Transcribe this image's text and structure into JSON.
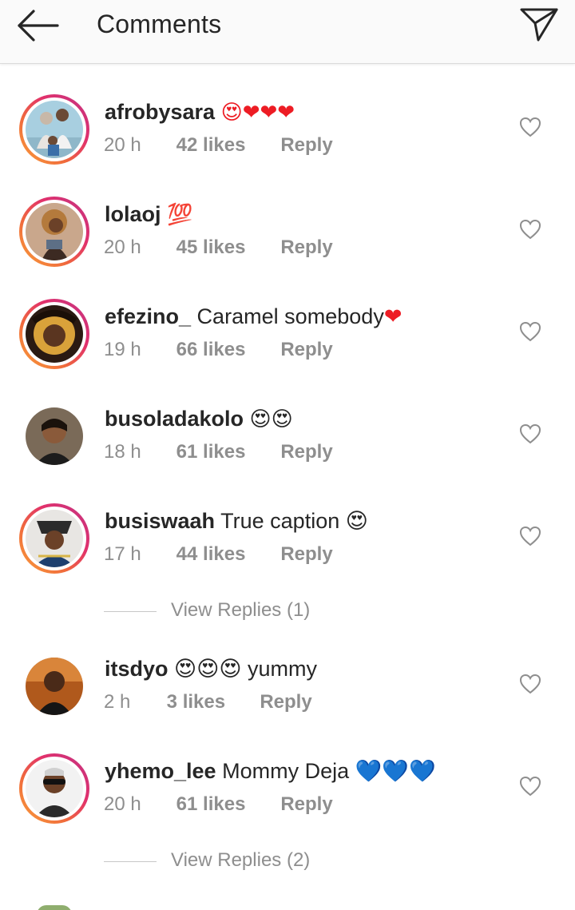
{
  "header": {
    "title": "Comments",
    "back_icon": "arrow-left-icon",
    "send_icon": "paper-plane-icon"
  },
  "comments": [
    {
      "username": "afrobysara",
      "text": "😍❤❤❤",
      "time": "20 h",
      "likes": "42 likes",
      "reply": "Reply",
      "story_ring": true
    },
    {
      "username": "lolaoj",
      "text": "💯",
      "time": "20 h",
      "likes": "45 likes",
      "reply": "Reply",
      "story_ring": true
    },
    {
      "username": "efezino_",
      "text": "Caramel somebody❤",
      "time": "19 h",
      "likes": "66 likes",
      "reply": "Reply",
      "story_ring": true
    },
    {
      "username": "busoladakolo",
      "text": "😍😍",
      "time": "18 h",
      "likes": "61 likes",
      "reply": "Reply",
      "story_ring": false
    },
    {
      "username": "busiswaah",
      "text": "True caption 😍",
      "time": "17 h",
      "likes": "44 likes",
      "reply": "Reply",
      "story_ring": true,
      "view_replies": "View Replies (1)"
    },
    {
      "username": "itsdyo",
      "text": "😍😍😍 yummy",
      "time": "2 h",
      "likes": "3 likes",
      "reply": "Reply",
      "story_ring": false
    },
    {
      "username": "yhemo_lee",
      "text": "Mommy Deja 💙💙💙",
      "time": "20 h",
      "likes": "61 likes",
      "reply": "Reply",
      "story_ring": true,
      "view_replies": "View Replies (2)"
    }
  ],
  "colors": {
    "accent_red": "#ed1c24",
    "meta_gray": "#8e8e8e",
    "ring_start": "#f9a13a",
    "ring_end": "#c13584",
    "blue_heart": "#1a8de0"
  }
}
